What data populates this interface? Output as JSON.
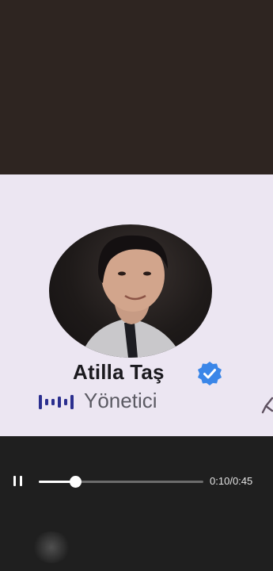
{
  "profile": {
    "name": "Atilla Taş",
    "role": "Yönetici",
    "verified": true
  },
  "player": {
    "current_time": "0:10",
    "separator": "/",
    "duration": "0:45",
    "progress_fraction": 0.22,
    "state": "playing"
  },
  "icons": {
    "pause": "pause-icon",
    "verified": "verified-badge-icon",
    "role": "waveform-icon"
  },
  "colors": {
    "verified_badge": "#3a86e8",
    "waveform": "#2b2f8f",
    "frame_background": "#ece6f2"
  }
}
